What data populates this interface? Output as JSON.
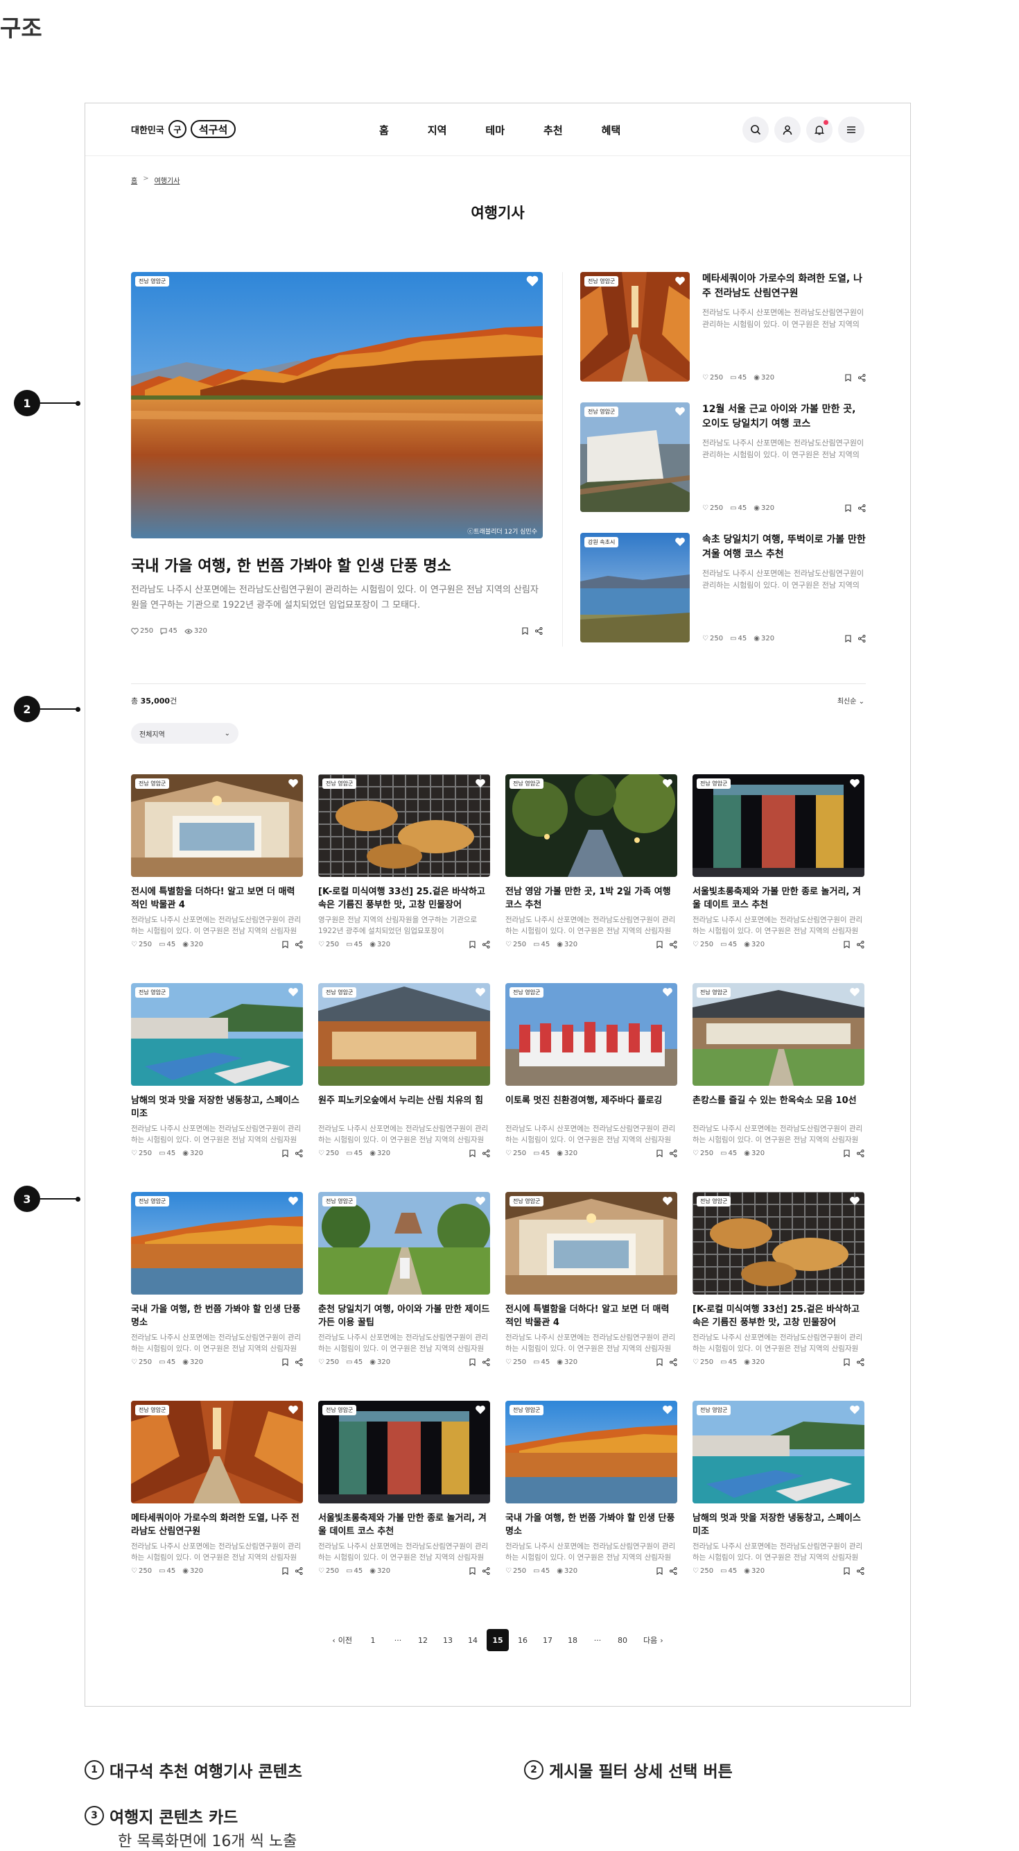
{
  "heading": "구조",
  "header": {
    "logo_left": "대한민국",
    "logo_mark": "구",
    "logo_right": "석구석",
    "nav": [
      "홈",
      "지역",
      "테마",
      "추천",
      "혜택"
    ]
  },
  "breadcrumb": {
    "home": "홈",
    "sep": ">",
    "current": "여행기사"
  },
  "title": "여행기사",
  "featured": {
    "badge": "전남 영암군",
    "credit": "ⓒ트래블리더 12기 심민수",
    "title": "국내 가을 여행, 한 번쯤 가봐야 할 인생 단풍 명소",
    "desc": "전라남도 나주시 산포면에는 전라남도산림연구원이 관리하는 시험림이 있다. 이 연구원은 전남 지역의 산림자원을 연구하는 기관으로 1922년 광주에 설치되었던 임업묘포장이 그 모태다.",
    "likes": "250",
    "comments": "45",
    "views": "320"
  },
  "side": [
    {
      "badge": "전남 영암군",
      "title": "메타세쿼이아 가로수의 화려한 도열, 나주 전라남도 산림연구원",
      "desc": "전라남도 나주시 산포면에는 전라남도산림연구원이 관리하는 시험림이 있다. 이 연구원은 전남 지역의",
      "likes": "250",
      "comments": "45",
      "views": "320"
    },
    {
      "badge": "전남 영암군",
      "title": "12월 서울 근교 아이와 가볼 만한 곳, 오이도 당일치기 여행 코스",
      "desc": "전라남도 나주시 산포면에는 전라남도산림연구원이 관리하는 시험림이 있다. 이 연구원은 전남 지역의",
      "likes": "250",
      "comments": "45",
      "views": "320"
    },
    {
      "badge": "강원 속초시",
      "title": "속초 당일치기 여행, 뚜벅이로 가볼 만한 겨울 여행 코스 추천",
      "desc": "전라남도 나주시 산포면에는 전라남도산림연구원이 관리하는 시험림이 있다. 이 연구원은 전남 지역의",
      "likes": "250",
      "comments": "45",
      "views": "320"
    }
  ],
  "list": {
    "total_prefix": "총",
    "total": "35,000",
    "total_suffix": "건",
    "sort": "최신순",
    "filter": "전체지역"
  },
  "cards": [
    {
      "badge": "전남 영암군",
      "img": "hanok",
      "title": "전시에 특별함을 더하다! 알고 보면 더 매력적인 박물관 4",
      "desc": "전라남도 나주시 산포면에는 전라남도산림연구원이 관리하는 시험림이 있다. 이 연구원은 전남 지역의 산림자원을",
      "likes": "250",
      "comments": "45",
      "views": "320"
    },
    {
      "badge": "전남 영암군",
      "img": "grill",
      "title": "[K-로컬 미식여행 33선] 25.겉은 바삭하고 속은 기름진 풍부한 맛, 고창 민물장어",
      "desc": "영구원은 전남 지역의 산림자원을 연구하는 기관으로 1922년 광주에 설치되었던 임업묘포장이",
      "likes": "250",
      "comments": "45",
      "views": "320"
    },
    {
      "badge": "전남 영암군",
      "img": "night",
      "title": "전남 영암 가볼 만한 곳, 1박 2일 가족 여행 코스 추천",
      "desc": "전라남도 나주시 산포면에는 전라남도산림연구원이 관리하는 시험림이 있다. 이 연구원은 전남 지역의 산림자원을",
      "likes": "250",
      "comments": "45",
      "views": "320"
    },
    {
      "badge": "전남 영암군",
      "img": "lights",
      "title": "서울빛초롱축제와 가볼 만한 종로 놀거리, 겨울 데이트 코스 추천",
      "desc": "전라남도 나주시 산포면에는 전라남도산림연구원이 관리하는 시험림이 있다. 이 연구원은 전남 지역의 산림자원을",
      "likes": "250",
      "comments": "45",
      "views": "320"
    },
    {
      "badge": "전남 영암군",
      "img": "harbor",
      "title": "남해의 멋과 맛을 저장한 냉동창고, 스페이스 미조",
      "desc": "전라남도 나주시 산포면에는 전라남도산림연구원이 관리하는 시험림이 있다. 이 연구원은 전남 지역의 산림자원을",
      "likes": "250",
      "comments": "45",
      "views": "320"
    },
    {
      "badge": "전남 영암군",
      "img": "temple",
      "title": "원주 피노키오숲에서 누리는 산림 치유의 힘",
      "desc": "전라남도 나주시 산포면에는 전라남도산림연구원이 관리하는 시험림이 있다. 이 연구원은 전남 지역의 산림자원을",
      "likes": "250",
      "comments": "45",
      "views": "320"
    },
    {
      "badge": "전남 영암군",
      "img": "group",
      "title": "이토록 멋진 친환경여행, 제주바다 플로깅",
      "desc": "전라남도 나주시 산포면에는 전라남도산림연구원이 관리하는 시험림이 있다. 이 연구원은 전남 지역의 산림자원을",
      "likes": "250",
      "comments": "45",
      "views": "320"
    },
    {
      "badge": "전남 영암군",
      "img": "hanokyard",
      "title": "촌캉스를 즐길 수 있는 한옥숙소 모음 10선",
      "desc": "전라남도 나주시 산포면에는 전라남도산림연구원이 관리하는 시험림이 있다. 이 연구원은 전남 지역의 산림자원을",
      "likes": "250",
      "comments": "45",
      "views": "320"
    },
    {
      "badge": "전남 영암군",
      "img": "autumn",
      "title": "국내 가을 여행, 한 번쯤 가봐야 할 인생 단풍 명소",
      "desc": "전라남도 나주시 산포면에는 전라남도산림연구원이 관리하는 시험림이 있다. 이 연구원은 전남 지역의 산림자원을",
      "likes": "250",
      "comments": "45",
      "views": "320"
    },
    {
      "badge": "전남 영암군",
      "img": "garden",
      "title": "춘천 당일치기 여행, 아이와 가볼 만한 제이드 가든 이용 꿀팁",
      "desc": "전라남도 나주시 산포면에는 전라남도산림연구원이 관리하는 시험림이 있다. 이 연구원은 전남 지역의 산림자원을",
      "likes": "250",
      "comments": "45",
      "views": "320"
    },
    {
      "badge": "전남 영암군",
      "img": "hanok",
      "title": "전시에 특별함을 더하다! 알고 보면 더 매력적인 박물관 4",
      "desc": "전라남도 나주시 산포면에는 전라남도산림연구원이 관리하는 시험림이 있다. 이 연구원은 전남 지역의 산림자원을",
      "likes": "250",
      "comments": "45",
      "views": "320"
    },
    {
      "badge": "전남 영암군",
      "img": "grill",
      "title": "[K-로컬 미식여행 33선] 25.겉은 바삭하고 속은 기름진 풍부한 맛, 고창 민물장어",
      "desc": "전라남도 나주시 산포면에는 전라남도산림연구원이 관리하는 시험림이 있다. 이 연구원은 전남 지역의 산림자원을",
      "likes": "250",
      "comments": "45",
      "views": "320"
    },
    {
      "badge": "전남 영암군",
      "img": "metasequoia",
      "title": "메타세쿼이아 가로수의 화려한 도열, 나주 전라남도 산림연구원",
      "desc": "전라남도 나주시 산포면에는 전라남도산림연구원이 관리하는 시험림이 있다. 이 연구원은 전남 지역의 산림자원을",
      "likes": "250",
      "comments": "45",
      "views": "320"
    },
    {
      "badge": "전남 영암군",
      "img": "lights",
      "title": "서울빛초롱축제와 가볼 만한 종로 놀거리, 겨울 데이트 코스 추천",
      "desc": "전라남도 나주시 산포면에는 전라남도산림연구원이 관리하는 시험림이 있다. 이 연구원은 전남 지역의 산림자원을",
      "likes": "250",
      "comments": "45",
      "views": "320"
    },
    {
      "badge": "전남 영암군",
      "img": "autumn",
      "title": "국내 가을 여행, 한 번쯤 가봐야 할 인생 단풍 명소",
      "desc": "전라남도 나주시 산포면에는 전라남도산림연구원이 관리하는 시험림이 있다. 이 연구원은 전남 지역의 산림자원을",
      "likes": "250",
      "comments": "45",
      "views": "320"
    },
    {
      "badge": "전남 영암군",
      "img": "harbor",
      "title": "남해의 멋과 맛을 저장한 냉동창고, 스페이스 미조",
      "desc": "전라남도 나주시 산포면에는 전라남도산림연구원이 관리하는 시험림이 있다. 이 연구원은 전남 지역의 산림자원을",
      "likes": "250",
      "comments": "45",
      "views": "320"
    }
  ],
  "pagination": {
    "prev": "이전",
    "next": "다음",
    "pages": [
      "1",
      "···",
      "12",
      "13",
      "14",
      "15",
      "16",
      "17",
      "18",
      "···",
      "80"
    ],
    "current": "15"
  },
  "annotations": [
    "1",
    "2",
    "3"
  ],
  "legend": [
    {
      "num": "1",
      "text": "대구석 추천 여행기사 콘텐츠"
    },
    {
      "num": "2",
      "text": "게시물 필터 상세 선택 버튼"
    },
    {
      "num": "3",
      "text": "여행지 콘텐츠 카드",
      "sub": "한 목록화면에 16개 씩 노출"
    }
  ]
}
